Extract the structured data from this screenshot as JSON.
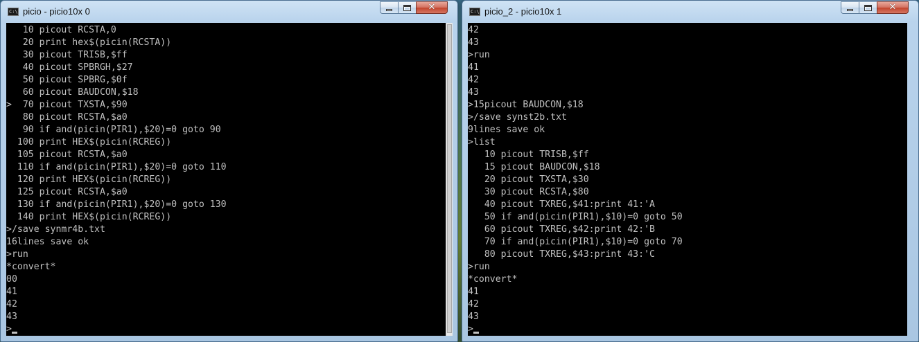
{
  "left_window": {
    "title": "picio - picio10x  0",
    "lines": [
      "   10 picout RCSTA,0",
      "   20 print hex$(picin(RCSTA))",
      "   30 picout TRISB,$ff",
      "   40 picout SPBRGH,$27",
      "   50 picout SPBRG,$0f",
      "   60 picout BAUDCON,$18",
      ">  70 picout TXSTA,$90",
      "   80 picout RCSTA,$a0",
      "   90 if and(picin(PIR1),$20)=0 goto 90",
      "  100 print HEX$(picin(RCREG))",
      "  105 picout RCSTA,$a0",
      "  110 if and(picin(PIR1),$20)=0 goto 110",
      "  120 print HEX$(picin(RCREG))",
      "  125 picout RCSTA,$a0",
      "  130 if and(picin(PIR1),$20)=0 goto 130",
      "  140 print HEX$(picin(RCREG))",
      ">/save synmr4b.txt",
      "16lines save ok",
      ">run",
      "*convert*",
      "00",
      "41",
      "42",
      "43",
      ">"
    ]
  },
  "right_window": {
    "title": "picio_2 - picio10x  1",
    "lines": [
      "42",
      "43",
      ">run",
      "41",
      "42",
      "43",
      ">15picout BAUDCON,$18",
      ">/save synst2b.txt",
      "9lines save ok",
      ">list",
      "   10 picout TRISB,$ff",
      "   15 picout BAUDCON,$18",
      "   20 picout TXSTA,$30",
      "   30 picout RCSTA,$80",
      "   40 picout TXREG,$41:print 41:'A",
      "   50 if and(picin(PIR1),$10)=0 goto 50",
      "   60 picout TXREG,$42:print 42:'B",
      "   70 if and(picin(PIR1),$10)=0 goto 70",
      "   80 picout TXREG,$43:print 43:'C",
      ">run",
      "*convert*",
      "41",
      "42",
      "43",
      ">"
    ]
  },
  "colors": {
    "console_bg": "#000000",
    "console_fg": "#c0c0c0"
  },
  "icons": {
    "window_icon": "console-icon",
    "minimize": "minimize-icon",
    "maximize": "maximize-icon",
    "close": "close-icon"
  }
}
